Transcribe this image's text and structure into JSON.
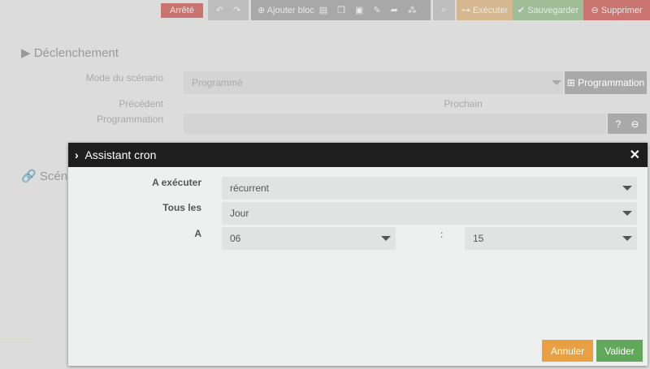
{
  "toolbar": {
    "status": "Arrêté",
    "undo_icon": "undo-icon",
    "redo_icon": "redo-icon",
    "add_block": "Ajouter bloc",
    "execute": "Exécuter",
    "save": "Sauvegarder",
    "delete": "Supprimer"
  },
  "trigger": {
    "title": "Déclenchement",
    "mode_label": "Mode du scénario",
    "mode_value": "Programmé",
    "programmation_button": "Programmation",
    "previous_label": "Précédent",
    "next_label": "Prochain",
    "programmation_label": "Programmation"
  },
  "scenario": {
    "title_partial": "Scéna"
  },
  "modal": {
    "title": "Assistant cron",
    "execute_label": "A exécuter",
    "execute_value": "récurrent",
    "every_label": "Tous les",
    "every_value": "Jour",
    "at_label": "A",
    "hour": "06",
    "separator": ":",
    "minute": "15",
    "cancel": "Annuler",
    "validate": "Valider"
  },
  "colors": {
    "danger": "#c9746f",
    "warning": "#d5b88f",
    "success": "#9fbd96",
    "overlay": "#dcdcdc",
    "modal_header": "#1e1e1e",
    "cancel": "#e8a043",
    "validate": "#62a85b"
  }
}
